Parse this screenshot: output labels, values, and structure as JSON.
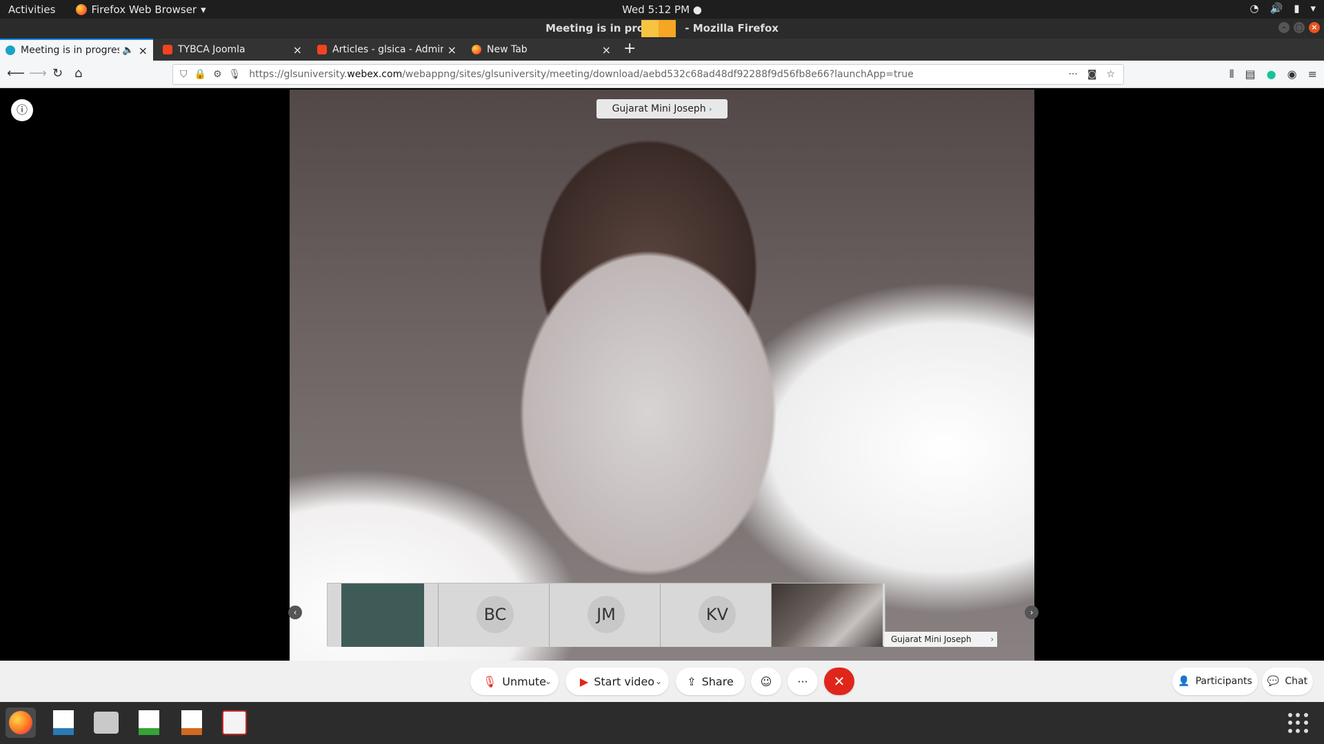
{
  "system_bar": {
    "activities": "Activities",
    "app_name": "Firefox Web Browser",
    "clock": "Wed  5:12 PM"
  },
  "window": {
    "title_left": "Meeting is in pro",
    "title_right": " - Mozilla Firefox"
  },
  "tabs": [
    {
      "label": "Meeting is in progress",
      "active": true
    },
    {
      "label": "TYBCA Joomla",
      "active": false
    },
    {
      "label": "Articles - glsica - Administration",
      "active": false
    },
    {
      "label": "New Tab",
      "active": false
    }
  ],
  "address_bar": {
    "url_prefix": "https://glsuniversity.",
    "url_domain": "webex.com",
    "url_path": "/webappng/sites/glsuniversity/meeting/download/aebd532c68ad48df92288f9d56fb8e66?launchApp=true"
  },
  "meeting": {
    "active_speaker": "Gujarat Mini Joseph",
    "participants": [
      {
        "initials": "",
        "kind": "video"
      },
      {
        "initials": "BC",
        "kind": "avatar"
      },
      {
        "initials": "JM",
        "kind": "avatar"
      },
      {
        "initials": "KV",
        "kind": "avatar"
      },
      {
        "initials": "",
        "kind": "video"
      }
    ],
    "self_name": "Gujarat Mini Joseph"
  },
  "controls": {
    "unmute": "Unmute",
    "start_video": "Start video",
    "share": "Share",
    "more": "···",
    "participants": "Participants",
    "chat": "Chat"
  },
  "colors": {
    "end_call": "#e0261b",
    "accent": "#0a84ff",
    "system_accent": "#e95420"
  }
}
